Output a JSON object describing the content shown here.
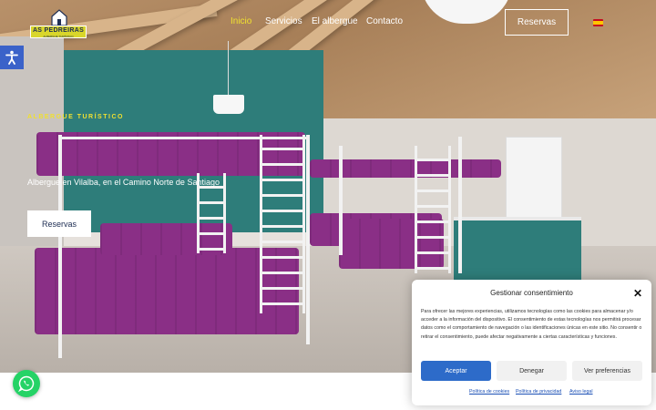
{
  "header": {
    "logo": {
      "name": "AS PEDREIRAS",
      "tagline": "ALBERGUE TURÍSTICO"
    },
    "nav": [
      {
        "label": "Inicio",
        "active": true
      },
      {
        "label": "Servicios",
        "active": false
      },
      {
        "label": "El albergue",
        "active": false
      },
      {
        "label": "Contacto",
        "active": false
      }
    ],
    "cta_label": "Reservas",
    "language_flag": "es-flag-icon"
  },
  "hero": {
    "kicker": "ALBERGUE TURÍSTICO",
    "subtitle": "Albergue en Vilalba, en el Camino Norte de Santiago",
    "button_label": "Reservas"
  },
  "widgets": {
    "accessibility_icon": "accessibility-icon",
    "whatsapp_icon": "whatsapp-icon"
  },
  "cookie_banner": {
    "title": "Gestionar consentimiento",
    "body": "Para ofrecer las mejores experiencias, utilizamos tecnologías como las cookies para almacenar y/o acceder a la información del dispositivo. El consentimiento de estas tecnologías nos permitirá procesar datos como el comportamiento de navegación o las identificaciones únicas en este sitio. No consentir o retirar el consentimiento, puede afectar negativamente a ciertas características y funciones.",
    "accept_label": "Aceptar",
    "deny_label": "Denegar",
    "preferences_label": "Ver preferencias",
    "links": [
      "Política de cookies",
      "Política de privacidad",
      "Aviso legal"
    ]
  },
  "colors": {
    "accent_yellow": "#f0e030",
    "accept_blue": "#2d6bc9",
    "whatsapp_green": "#25d366",
    "a11y_blue": "#3a62c9",
    "mattress_purple": "#8a2f86",
    "wall_teal": "#2e7d7a"
  }
}
